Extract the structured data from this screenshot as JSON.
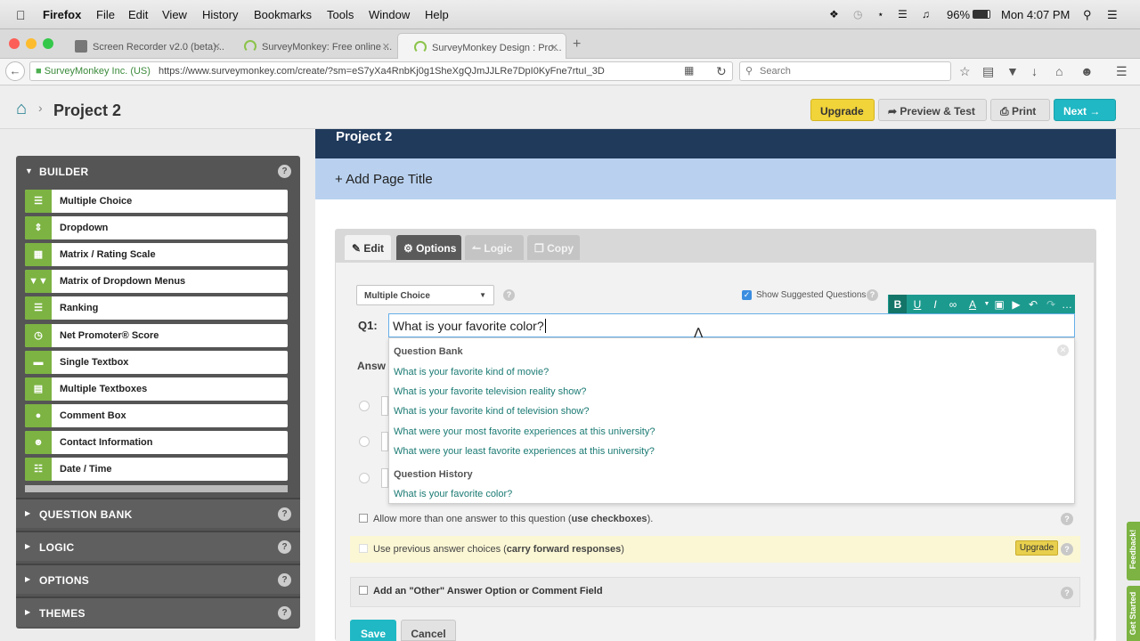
{
  "menubar": {
    "app_name": "Firefox",
    "items": [
      "File",
      "Edit",
      "View",
      "History",
      "Bookmarks",
      "Tools",
      "Window",
      "Help"
    ],
    "battery": "96%",
    "clock": "Mon 4:07 PM"
  },
  "tabs": [
    {
      "label": "Screen Recorder v2.0 (beta)..."
    },
    {
      "label": "SurveyMonkey: Free online ..."
    },
    {
      "label": "SurveyMonkey Design : Pro..."
    }
  ],
  "nav": {
    "site_identity": "SurveyMonkey Inc. (US)",
    "url": "https://www.surveymonkey.com/create/?sm=eS7yXa4RnbKj0g1SheXgQJmJJLRe7DpI0KyFne7rtuI_3D",
    "search_placeholder": "Search"
  },
  "header": {
    "project_title": "Project 2",
    "upgrade_label": "Upgrade",
    "preview_label": "Preview & Test",
    "print_label": "Print",
    "next_label": "Next"
  },
  "sidebar": {
    "builder_label": "BUILDER",
    "items": [
      {
        "label": "Multiple Choice",
        "icon": "list-icon"
      },
      {
        "label": "Dropdown",
        "icon": "dropdown-icon"
      },
      {
        "label": "Matrix / Rating Scale",
        "icon": "grid-icon"
      },
      {
        "label": "Matrix of Dropdown Menus",
        "icon": "matrix-dropdown-icon"
      },
      {
        "label": "Ranking",
        "icon": "ranking-icon"
      },
      {
        "label": "Net Promoter® Score",
        "icon": "gauge-icon"
      },
      {
        "label": "Single Textbox",
        "icon": "textbox-icon"
      },
      {
        "label": "Multiple Textboxes",
        "icon": "textboxes-icon"
      },
      {
        "label": "Comment Box",
        "icon": "comment-icon"
      },
      {
        "label": "Contact Information",
        "icon": "person-icon"
      },
      {
        "label": "Date / Time",
        "icon": "calendar-icon"
      }
    ],
    "sections": [
      {
        "label": "QUESTION BANK"
      },
      {
        "label": "LOGIC"
      },
      {
        "label": "OPTIONS"
      },
      {
        "label": "THEMES"
      }
    ]
  },
  "main": {
    "project_banner": "Project 2",
    "add_page_title": "+ Add Page Title",
    "tabs": {
      "edit": "Edit",
      "options": "Options",
      "logic": "Logic",
      "copy": "Copy"
    },
    "question_type": "Multiple Choice",
    "show_suggested": "Show Suggested Questions",
    "question_number": "Q1:",
    "question_text": "What is your favorite color?",
    "answer_label_partial": "Answ",
    "suggestions": {
      "bank_heading": "Question Bank",
      "bank_items": [
        "What is your favorite kind of movie?",
        "What is your favorite television reality show?",
        "What is your favorite kind of television show?",
        "What were your most favorite experiences at this university?",
        "What were your least favorite experiences at this university?"
      ],
      "history_heading": "Question History",
      "history_items": [
        "What is your favorite color?"
      ]
    },
    "allow_multiple": {
      "text": "Allow more than one answer to this question (",
      "bold": "use checkboxes",
      "end": ")."
    },
    "carry_forward": {
      "text": "Use previous answer choices (",
      "bold": "carry forward responses",
      "end": ")",
      "upgrade": "Upgrade"
    },
    "other_option": "Add an \"Other\" Answer Option or Comment Field",
    "save_label": "Save",
    "cancel_label": "Cancel"
  },
  "feedback_tab": "Feedback!",
  "getstarted_tab": "Get Started",
  "colors": {
    "green": "#7cb342",
    "navy": "#203a5c",
    "teal": "#1fb8c4",
    "yellow": "#f1d33a"
  }
}
